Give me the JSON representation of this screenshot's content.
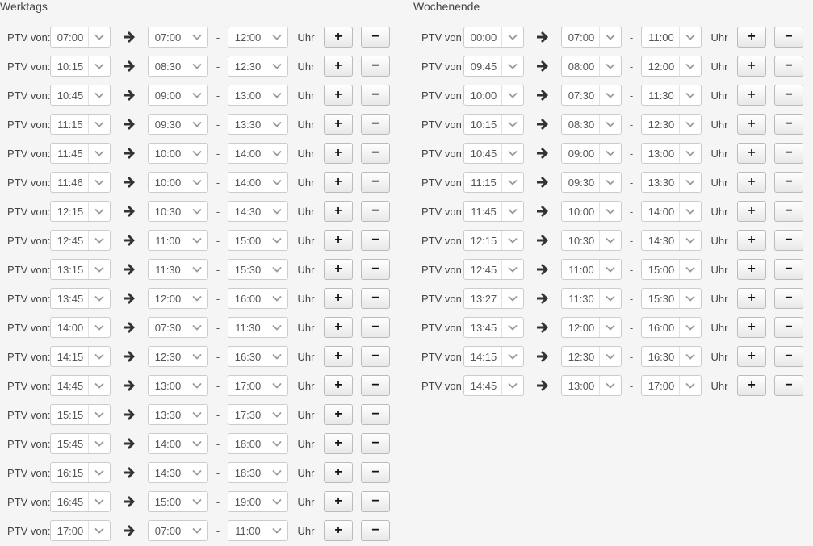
{
  "sections": [
    {
      "title": "Werktags",
      "rows": [
        {
          "label": "PTV von:",
          "from": "07:00",
          "start": "07:00",
          "end": "12:00",
          "unit": "Uhr",
          "add": "+",
          "remove": "−"
        },
        {
          "label": "PTV von:",
          "from": "10:15",
          "start": "08:30",
          "end": "12:30",
          "unit": "Uhr",
          "add": "+",
          "remove": "−"
        },
        {
          "label": "PTV von:",
          "from": "10:45",
          "start": "09:00",
          "end": "13:00",
          "unit": "Uhr",
          "add": "+",
          "remove": "−"
        },
        {
          "label": "PTV von:",
          "from": "11:15",
          "start": "09:30",
          "end": "13:30",
          "unit": "Uhr",
          "add": "+",
          "remove": "−"
        },
        {
          "label": "PTV von:",
          "from": "11:45",
          "start": "10:00",
          "end": "14:00",
          "unit": "Uhr",
          "add": "+",
          "remove": "−"
        },
        {
          "label": "PTV von:",
          "from": "11:46",
          "start": "10:00",
          "end": "14:00",
          "unit": "Uhr",
          "add": "+",
          "remove": "−"
        },
        {
          "label": "PTV von:",
          "from": "12:15",
          "start": "10:30",
          "end": "14:30",
          "unit": "Uhr",
          "add": "+",
          "remove": "−"
        },
        {
          "label": "PTV von:",
          "from": "12:45",
          "start": "11:00",
          "end": "15:00",
          "unit": "Uhr",
          "add": "+",
          "remove": "−"
        },
        {
          "label": "PTV von:",
          "from": "13:15",
          "start": "11:30",
          "end": "15:30",
          "unit": "Uhr",
          "add": "+",
          "remove": "−"
        },
        {
          "label": "PTV von:",
          "from": "13:45",
          "start": "12:00",
          "end": "16:00",
          "unit": "Uhr",
          "add": "+",
          "remove": "−"
        },
        {
          "label": "PTV von:",
          "from": "14:00",
          "start": "07:30",
          "end": "11:30",
          "unit": "Uhr",
          "add": "+",
          "remove": "−"
        },
        {
          "label": "PTV von:",
          "from": "14:15",
          "start": "12:30",
          "end": "16:30",
          "unit": "Uhr",
          "add": "+",
          "remove": "−"
        },
        {
          "label": "PTV von:",
          "from": "14:45",
          "start": "13:00",
          "end": "17:00",
          "unit": "Uhr",
          "add": "+",
          "remove": "−"
        },
        {
          "label": "PTV von:",
          "from": "15:15",
          "start": "13:30",
          "end": "17:30",
          "unit": "Uhr",
          "add": "+",
          "remove": "−"
        },
        {
          "label": "PTV von:",
          "from": "15:45",
          "start": "14:00",
          "end": "18:00",
          "unit": "Uhr",
          "add": "+",
          "remove": "−"
        },
        {
          "label": "PTV von:",
          "from": "16:15",
          "start": "14:30",
          "end": "18:30",
          "unit": "Uhr",
          "add": "+",
          "remove": "−"
        },
        {
          "label": "PTV von:",
          "from": "16:45",
          "start": "15:00",
          "end": "19:00",
          "unit": "Uhr",
          "add": "+",
          "remove": "−"
        },
        {
          "label": "PTV von:",
          "from": "17:00",
          "start": "07:00",
          "end": "11:00",
          "unit": "Uhr",
          "add": "+",
          "remove": "−"
        }
      ]
    },
    {
      "title": "Wochenende",
      "rows": [
        {
          "label": "PTV von:",
          "from": "00:00",
          "start": "07:00",
          "end": "11:00",
          "unit": "Uhr",
          "add": "+",
          "remove": "−"
        },
        {
          "label": "PTV von:",
          "from": "09:45",
          "start": "08:00",
          "end": "12:00",
          "unit": "Uhr",
          "add": "+",
          "remove": "−"
        },
        {
          "label": "PTV von:",
          "from": "10:00",
          "start": "07:30",
          "end": "11:30",
          "unit": "Uhr",
          "add": "+",
          "remove": "−"
        },
        {
          "label": "PTV von:",
          "from": "10:15",
          "start": "08:30",
          "end": "12:30",
          "unit": "Uhr",
          "add": "+",
          "remove": "−"
        },
        {
          "label": "PTV von:",
          "from": "10:45",
          "start": "09:00",
          "end": "13:00",
          "unit": "Uhr",
          "add": "+",
          "remove": "−"
        },
        {
          "label": "PTV von:",
          "from": "11:15",
          "start": "09:30",
          "end": "13:30",
          "unit": "Uhr",
          "add": "+",
          "remove": "−"
        },
        {
          "label": "PTV von:",
          "from": "11:45",
          "start": "10:00",
          "end": "14:00",
          "unit": "Uhr",
          "add": "+",
          "remove": "−"
        },
        {
          "label": "PTV von:",
          "from": "12:15",
          "start": "10:30",
          "end": "14:30",
          "unit": "Uhr",
          "add": "+",
          "remove": "−"
        },
        {
          "label": "PTV von:",
          "from": "12:45",
          "start": "11:00",
          "end": "15:00",
          "unit": "Uhr",
          "add": "+",
          "remove": "−"
        },
        {
          "label": "PTV von:",
          "from": "13:27",
          "start": "11:30",
          "end": "15:30",
          "unit": "Uhr",
          "add": "+",
          "remove": "−"
        },
        {
          "label": "PTV von:",
          "from": "13:45",
          "start": "12:00",
          "end": "16:00",
          "unit": "Uhr",
          "add": "+",
          "remove": "−"
        },
        {
          "label": "PTV von:",
          "from": "14:15",
          "start": "12:30",
          "end": "16:30",
          "unit": "Uhr",
          "add": "+",
          "remove": "−"
        },
        {
          "label": "PTV von:",
          "from": "14:45",
          "start": "13:00",
          "end": "17:00",
          "unit": "Uhr",
          "add": "+",
          "remove": "−"
        }
      ]
    }
  ],
  "icons": {
    "row_arrow": "arrow-right-icon",
    "select_caret": "chevron-down-icon"
  },
  "colors": {
    "background": "#f5f5f5",
    "border": "#cccccc",
    "text": "#444444"
  }
}
